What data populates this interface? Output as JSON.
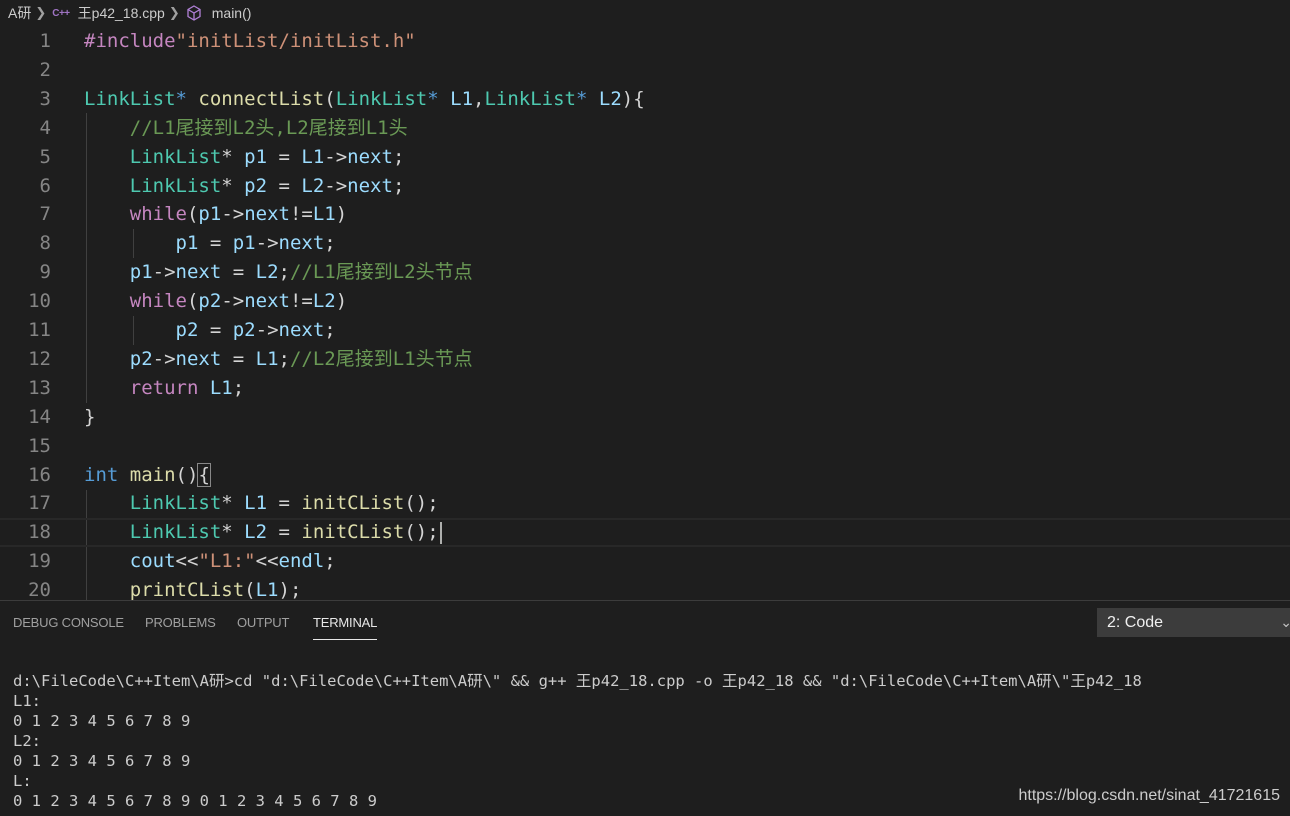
{
  "breadcrumb": {
    "folder": "A研",
    "file": "王p42_18.cpp",
    "file_icon": "C++",
    "symbol": "main()"
  },
  "editor": {
    "lines": [
      {
        "n": "1",
        "tokens": [
          [
            "pp",
            "#include"
          ],
          [
            "str",
            "\"initList/initList.h\""
          ]
        ]
      },
      {
        "n": "2",
        "tokens": []
      },
      {
        "n": "3",
        "tokens": [
          [
            "type",
            "LinkList"
          ],
          [
            "kw",
            "*"
          ],
          [
            "punc",
            " "
          ],
          [
            "fn",
            "connectList"
          ],
          [
            "punc",
            "("
          ],
          [
            "type",
            "LinkList"
          ],
          [
            "kw",
            "*"
          ],
          [
            "punc",
            " "
          ],
          [
            "var",
            "L1"
          ],
          [
            "punc",
            ","
          ],
          [
            "type",
            "LinkList"
          ],
          [
            "kw",
            "*"
          ],
          [
            "punc",
            " "
          ],
          [
            "var",
            "L2"
          ],
          [
            "punc",
            "){"
          ]
        ]
      },
      {
        "n": "4",
        "tokens": [
          [
            "punc",
            "    "
          ],
          [
            "cm",
            "//L1尾接到L2头,L2尾接到L1头"
          ]
        ]
      },
      {
        "n": "5",
        "tokens": [
          [
            "punc",
            "    "
          ],
          [
            "type",
            "LinkList"
          ],
          [
            "punc",
            "* "
          ],
          [
            "var",
            "p1"
          ],
          [
            "punc",
            " = "
          ],
          [
            "var",
            "L1"
          ],
          [
            "punc",
            "->"
          ],
          [
            "var",
            "next"
          ],
          [
            "punc",
            ";"
          ]
        ]
      },
      {
        "n": "6",
        "tokens": [
          [
            "punc",
            "    "
          ],
          [
            "type",
            "LinkList"
          ],
          [
            "punc",
            "* "
          ],
          [
            "var",
            "p2"
          ],
          [
            "punc",
            " = "
          ],
          [
            "var",
            "L2"
          ],
          [
            "punc",
            "->"
          ],
          [
            "var",
            "next"
          ],
          [
            "punc",
            ";"
          ]
        ]
      },
      {
        "n": "7",
        "tokens": [
          [
            "punc",
            "    "
          ],
          [
            "ctrl",
            "while"
          ],
          [
            "punc",
            "("
          ],
          [
            "var",
            "p1"
          ],
          [
            "punc",
            "->"
          ],
          [
            "var",
            "next"
          ],
          [
            "punc",
            "!="
          ],
          [
            "var",
            "L1"
          ],
          [
            "punc",
            ")"
          ]
        ]
      },
      {
        "n": "8",
        "tokens": [
          [
            "punc",
            "        "
          ],
          [
            "var",
            "p1"
          ],
          [
            "punc",
            " = "
          ],
          [
            "var",
            "p1"
          ],
          [
            "punc",
            "->"
          ],
          [
            "var",
            "next"
          ],
          [
            "punc",
            ";"
          ]
        ]
      },
      {
        "n": "9",
        "tokens": [
          [
            "punc",
            "    "
          ],
          [
            "var",
            "p1"
          ],
          [
            "punc",
            "->"
          ],
          [
            "var",
            "next"
          ],
          [
            "punc",
            " = "
          ],
          [
            "var",
            "L2"
          ],
          [
            "punc",
            ";"
          ],
          [
            "cm",
            "//L1尾接到L2头节点"
          ]
        ]
      },
      {
        "n": "10",
        "tokens": [
          [
            "punc",
            "    "
          ],
          [
            "ctrl",
            "while"
          ],
          [
            "punc",
            "("
          ],
          [
            "var",
            "p2"
          ],
          [
            "punc",
            "->"
          ],
          [
            "var",
            "next"
          ],
          [
            "punc",
            "!="
          ],
          [
            "var",
            "L2"
          ],
          [
            "punc",
            ")"
          ]
        ]
      },
      {
        "n": "11",
        "tokens": [
          [
            "punc",
            "        "
          ],
          [
            "var",
            "p2"
          ],
          [
            "punc",
            " = "
          ],
          [
            "var",
            "p2"
          ],
          [
            "punc",
            "->"
          ],
          [
            "var",
            "next"
          ],
          [
            "punc",
            ";"
          ]
        ]
      },
      {
        "n": "12",
        "tokens": [
          [
            "punc",
            "    "
          ],
          [
            "var",
            "p2"
          ],
          [
            "punc",
            "->"
          ],
          [
            "var",
            "next"
          ],
          [
            "punc",
            " = "
          ],
          [
            "var",
            "L1"
          ],
          [
            "punc",
            ";"
          ],
          [
            "cm",
            "//L2尾接到L1头节点"
          ]
        ]
      },
      {
        "n": "13",
        "tokens": [
          [
            "punc",
            "    "
          ],
          [
            "ctrl",
            "return"
          ],
          [
            "punc",
            " "
          ],
          [
            "var",
            "L1"
          ],
          [
            "punc",
            ";"
          ]
        ]
      },
      {
        "n": "14",
        "tokens": [
          [
            "punc",
            "}"
          ]
        ]
      },
      {
        "n": "15",
        "tokens": []
      },
      {
        "n": "16",
        "tokens": [
          [
            "kw",
            "int"
          ],
          [
            "punc",
            " "
          ],
          [
            "fn",
            "main"
          ],
          [
            "punc",
            "()"
          ],
          [
            "punc",
            "{"
          ]
        ]
      },
      {
        "n": "17",
        "tokens": [
          [
            "punc",
            "    "
          ],
          [
            "type",
            "LinkList"
          ],
          [
            "punc",
            "* "
          ],
          [
            "var",
            "L1"
          ],
          [
            "punc",
            " = "
          ],
          [
            "fn",
            "initCList"
          ],
          [
            "punc",
            "();"
          ]
        ]
      },
      {
        "n": "18",
        "tokens": [
          [
            "punc",
            "    "
          ],
          [
            "type",
            "LinkList"
          ],
          [
            "punc",
            "* "
          ],
          [
            "var",
            "L2"
          ],
          [
            "punc",
            " = "
          ],
          [
            "fn",
            "initCList"
          ],
          [
            "punc",
            "();"
          ]
        ]
      },
      {
        "n": "19",
        "tokens": [
          [
            "punc",
            "    "
          ],
          [
            "var",
            "cout"
          ],
          [
            "punc",
            "<<"
          ],
          [
            "str",
            "\"L1:\""
          ],
          [
            "punc",
            "<<"
          ],
          [
            "var",
            "endl"
          ],
          [
            "punc",
            ";"
          ]
        ]
      },
      {
        "n": "20",
        "tokens": [
          [
            "punc",
            "    "
          ],
          [
            "fn",
            "printCList"
          ],
          [
            "punc",
            "("
          ],
          [
            "var",
            "L1"
          ],
          [
            "punc",
            ");"
          ]
        ]
      }
    ]
  },
  "panel": {
    "tabs": [
      "DEBUG CONSOLE",
      "PROBLEMS",
      "OUTPUT",
      "TERMINAL"
    ],
    "active_tab": "TERMINAL",
    "terminal_select": "2: Code"
  },
  "terminal": {
    "lines": [
      "d:\\FileCode\\C++Item\\A研>cd \"d:\\FileCode\\C++Item\\A研\\\" && g++ 王p42_18.cpp -o 王p42_18 && \"d:\\FileCode\\C++Item\\A研\\\"王p42_18",
      "L1:",
      "0 1 2 3 4 5 6 7 8 9",
      "L2:",
      "0 1 2 3 4 5 6 7 8 9",
      "L:",
      "0 1 2 3 4 5 6 7 8 9 0 1 2 3 4 5 6 7 8 9"
    ]
  },
  "watermark": "https://blog.csdn.net/sinat_41721615",
  "colors": {
    "background": "#1e1e1e",
    "preprocessor": "#c586c0",
    "string": "#ce9178",
    "type": "#4ec9b0",
    "function": "#dcdcaa",
    "variable": "#9cdcfe",
    "keyword": "#569cd6",
    "comment": "#6a9955"
  }
}
